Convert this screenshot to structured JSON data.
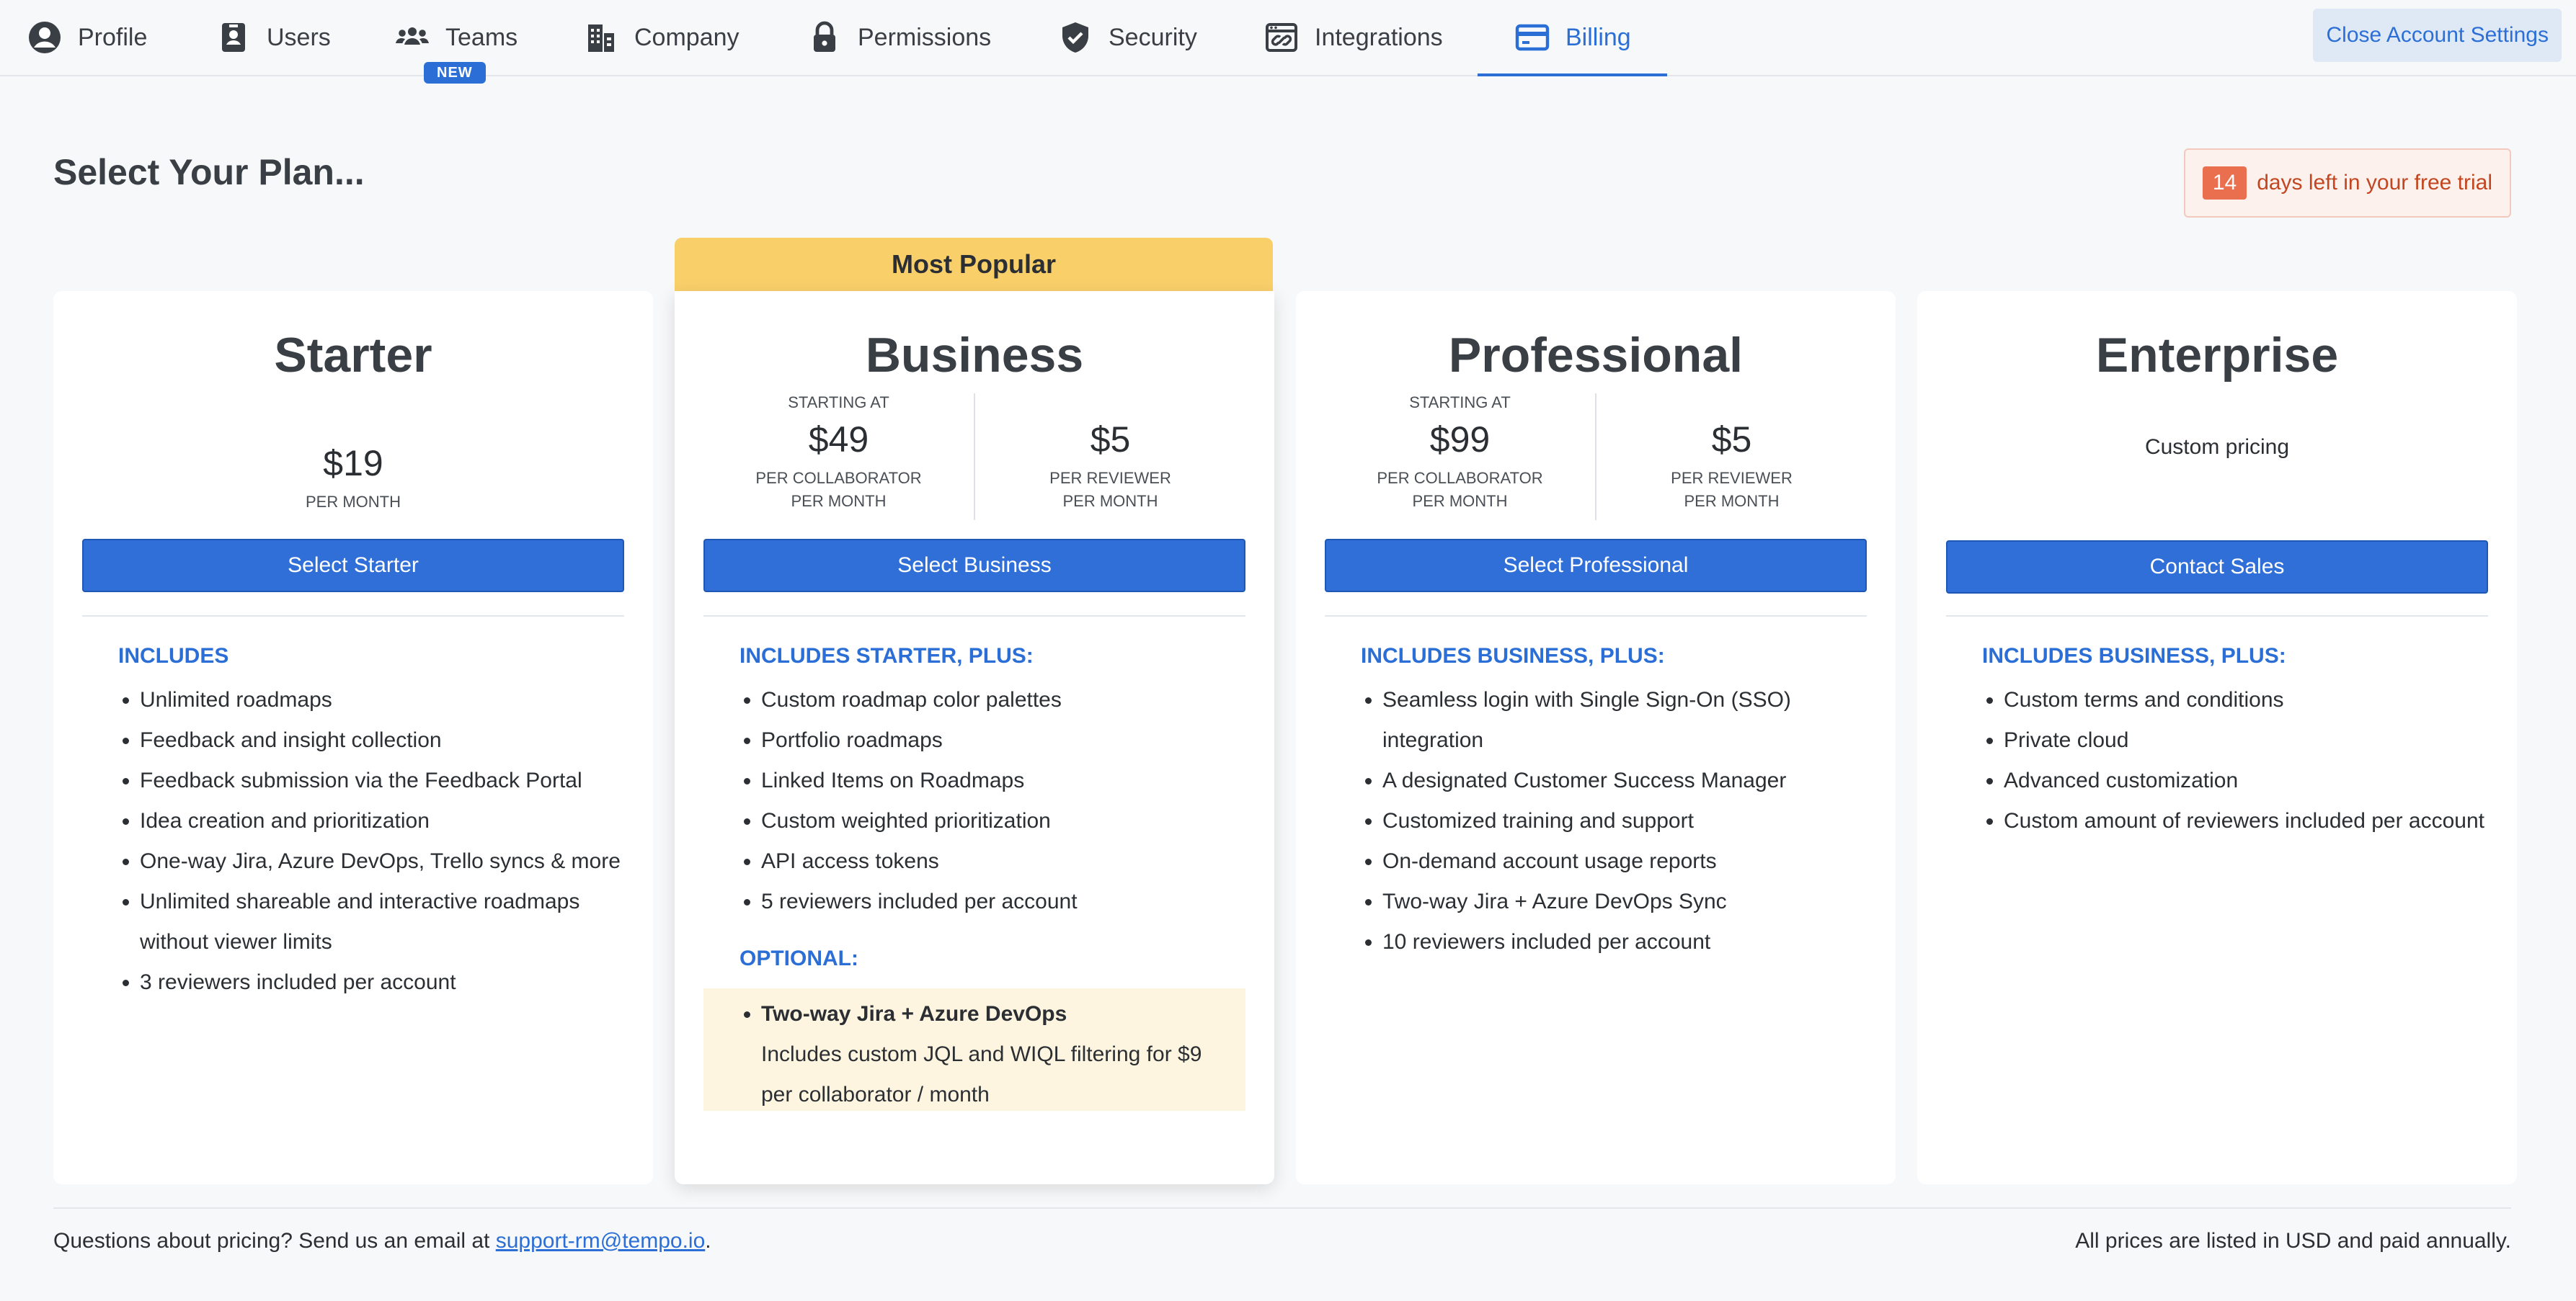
{
  "nav": {
    "tabs": [
      {
        "label": "Profile",
        "icon": "user-circle-icon"
      },
      {
        "label": "Users",
        "icon": "id-badge-icon"
      },
      {
        "label": "Teams",
        "icon": "group-icon",
        "badge": "NEW"
      },
      {
        "label": "Company",
        "icon": "building-icon"
      },
      {
        "label": "Permissions",
        "icon": "lock-icon"
      },
      {
        "label": "Security",
        "icon": "shield-check-icon"
      },
      {
        "label": "Integrations",
        "icon": "link-window-icon"
      },
      {
        "label": "Billing",
        "icon": "credit-card-icon",
        "active": true
      }
    ],
    "close_label": "Close Account Settings",
    "accent_color": "#2b6fd6"
  },
  "header": {
    "title": "Select Your Plan...",
    "trial_days": "14",
    "trial_text": "days left in your free trial"
  },
  "popular_label": "Most Popular",
  "plans": {
    "starter": {
      "name": "Starter",
      "price": "$19",
      "price_unit": "PER MONTH",
      "button": "Select Starter",
      "includes_head": "INCLUDES",
      "features": [
        "Unlimited roadmaps",
        "Feedback and insight collection",
        "Feedback submission via the Feedback Portal",
        "Idea creation and prioritization",
        "One-way Jira, Azure DevOps, Trello syncs & more",
        "Unlimited shareable and interactive roadmaps without viewer limits",
        "3 reviewers included per account"
      ]
    },
    "business": {
      "name": "Business",
      "starting_at": "STARTING AT",
      "price_collab": "$49",
      "collab_unit_1": "PER COLLABORATOR",
      "collab_unit_2": "PER MONTH",
      "price_reviewer": "$5",
      "reviewer_unit_1": "PER REVIEWER",
      "reviewer_unit_2": "PER MONTH",
      "button": "Select Business",
      "includes_head": "INCLUDES STARTER, PLUS:",
      "features": [
        "Custom roadmap color palettes",
        "Portfolio roadmaps",
        "Linked Items on Roadmaps",
        "Custom weighted prioritization",
        "API access tokens",
        "5 reviewers included per account"
      ],
      "optional_head": "OPTIONAL:",
      "optional_title": "Two-way Jira + Azure DevOps",
      "optional_desc": "Includes custom JQL and WIQL filtering for $9 per collaborator / month"
    },
    "professional": {
      "name": "Professional",
      "starting_at": "STARTING AT",
      "price_collab": "$99",
      "collab_unit_1": "PER COLLABORATOR",
      "collab_unit_2": "PER MONTH",
      "price_reviewer": "$5",
      "reviewer_unit_1": "PER REVIEWER",
      "reviewer_unit_2": "PER MONTH",
      "button": "Select Professional",
      "includes_head": "INCLUDES BUSINESS, PLUS:",
      "features": [
        "Seamless login with Single Sign-On (SSO) integration",
        "A designated Customer Success Manager",
        "Customized training and support",
        "On-demand account usage reports",
        "Two-way Jira + Azure DevOps Sync",
        "10 reviewers included per account"
      ]
    },
    "enterprise": {
      "name": "Enterprise",
      "price_text": "Custom pricing",
      "button": "Contact Sales",
      "includes_head": "INCLUDES BUSINESS, PLUS:",
      "features": [
        "Custom terms and conditions",
        "Private cloud",
        "Advanced customization",
        "Custom amount of reviewers included per account"
      ]
    }
  },
  "footer": {
    "question_text": "Questions about pricing? Send us an email at ",
    "email": "support-rm@tempo.io",
    "question_end": ".",
    "note": "All prices are listed in USD and paid annually."
  }
}
